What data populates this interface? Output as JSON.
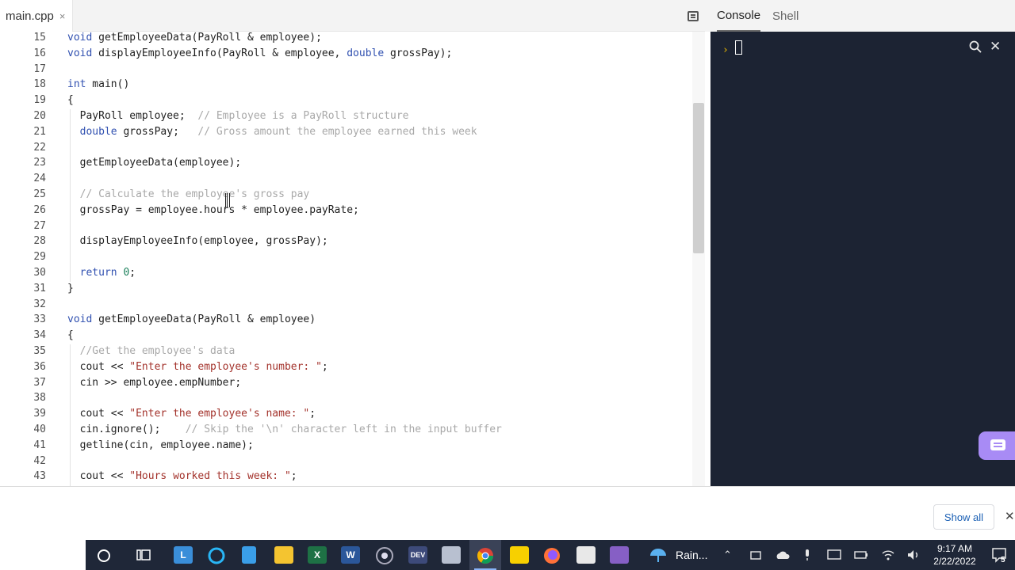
{
  "editor": {
    "tab_label": "main.cpp",
    "tab_close": "×",
    "lines": [
      {
        "n": "15",
        "segs": [
          {
            "t": "void",
            "c": "kw"
          },
          {
            "t": " getEmployeeData(PayRoll & employee);",
            "c": ""
          }
        ]
      },
      {
        "n": "16",
        "segs": [
          {
            "t": "void",
            "c": "kw"
          },
          {
            "t": " displayEmployeeInfo(PayRoll & employee, ",
            "c": ""
          },
          {
            "t": "double",
            "c": "kw"
          },
          {
            "t": " grossPay);",
            "c": ""
          }
        ]
      },
      {
        "n": "17",
        "segs": []
      },
      {
        "n": "18",
        "segs": [
          {
            "t": "int",
            "c": "kw"
          },
          {
            "t": " main()",
            "c": ""
          }
        ]
      },
      {
        "n": "19",
        "segs": [
          {
            "t": "{",
            "c": ""
          }
        ]
      },
      {
        "n": "20",
        "segs": [
          {
            "t": "  PayRoll employee;  ",
            "c": ""
          },
          {
            "t": "// Employee is a PayRoll structure",
            "c": "cmt"
          }
        ]
      },
      {
        "n": "21",
        "segs": [
          {
            "t": "  ",
            "c": ""
          },
          {
            "t": "double",
            "c": "kw"
          },
          {
            "t": " grossPay;   ",
            "c": ""
          },
          {
            "t": "// Gross amount the employee earned this week",
            "c": "cmt"
          }
        ]
      },
      {
        "n": "22",
        "segs": []
      },
      {
        "n": "23",
        "segs": [
          {
            "t": "  getEmployeeData(employee);",
            "c": ""
          }
        ]
      },
      {
        "n": "24",
        "segs": []
      },
      {
        "n": "25",
        "segs": [
          {
            "t": "  ",
            "c": ""
          },
          {
            "t": "// Calculate the employee's gross pay",
            "c": "cmt"
          }
        ]
      },
      {
        "n": "26",
        "segs": [
          {
            "t": "  grossPay = employee.hours * employee.payRate;",
            "c": ""
          }
        ]
      },
      {
        "n": "27",
        "segs": []
      },
      {
        "n": "28",
        "segs": [
          {
            "t": "  displayEmployeeInfo(employee, grossPay);",
            "c": ""
          }
        ]
      },
      {
        "n": "29",
        "segs": []
      },
      {
        "n": "30",
        "segs": [
          {
            "t": "  ",
            "c": ""
          },
          {
            "t": "return",
            "c": "kw"
          },
          {
            "t": " ",
            "c": ""
          },
          {
            "t": "0",
            "c": "num"
          },
          {
            "t": ";",
            "c": ""
          }
        ]
      },
      {
        "n": "31",
        "segs": [
          {
            "t": "}",
            "c": ""
          }
        ]
      },
      {
        "n": "32",
        "segs": []
      },
      {
        "n": "33",
        "segs": [
          {
            "t": "void",
            "c": "kw"
          },
          {
            "t": " getEmployeeData(PayRoll & employee)",
            "c": ""
          }
        ]
      },
      {
        "n": "34",
        "segs": [
          {
            "t": "{",
            "c": ""
          }
        ]
      },
      {
        "n": "35",
        "segs": [
          {
            "t": "  ",
            "c": ""
          },
          {
            "t": "//Get the employee's data",
            "c": "cmt"
          }
        ]
      },
      {
        "n": "36",
        "segs": [
          {
            "t": "  cout << ",
            "c": ""
          },
          {
            "t": "\"Enter the employee's number: \"",
            "c": "str"
          },
          {
            "t": ";",
            "c": ""
          }
        ]
      },
      {
        "n": "37",
        "segs": [
          {
            "t": "  cin >> employee.empNumber;",
            "c": ""
          }
        ]
      },
      {
        "n": "38",
        "segs": []
      },
      {
        "n": "39",
        "segs": [
          {
            "t": "  cout << ",
            "c": ""
          },
          {
            "t": "\"Enter the employee's name: \"",
            "c": "str"
          },
          {
            "t": ";",
            "c": ""
          }
        ]
      },
      {
        "n": "40",
        "segs": [
          {
            "t": "  cin.ignore();    ",
            "c": ""
          },
          {
            "t": "// Skip the '\\n' character left in the input buffer",
            "c": "cmt"
          }
        ]
      },
      {
        "n": "41",
        "segs": [
          {
            "t": "  getline(cin, employee.name);",
            "c": ""
          }
        ]
      },
      {
        "n": "42",
        "segs": []
      },
      {
        "n": "43",
        "segs": [
          {
            "t": "  cout << ",
            "c": ""
          },
          {
            "t": "\"Hours worked this week: \"",
            "c": "str"
          },
          {
            "t": ";",
            "c": ""
          }
        ]
      }
    ]
  },
  "console_panel": {
    "tabs": [
      "Console",
      "Shell"
    ],
    "active_tab": "Console",
    "prompt_symbol": "›",
    "close_glyph": "✕"
  },
  "downloads": {
    "show_all_label": "Show all",
    "close_glyph": "✕"
  },
  "taskbar": {
    "weather_label": "Rain...",
    "time": "9:17 AM",
    "date": "2/22/2022",
    "notification_count": "5",
    "app_letters": {
      "launcher": "L",
      "excel": "X",
      "word": "W",
      "devcpp": "DEV"
    },
    "colors": {
      "excel": "#1e7145",
      "word": "#2b579a",
      "vs": "#865fc5",
      "chrome_active": "#3a4257"
    }
  }
}
